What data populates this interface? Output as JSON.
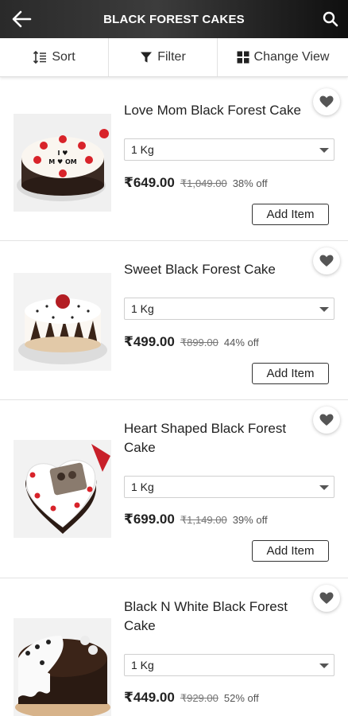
{
  "header": {
    "title": "BLACK FOREST CAKES",
    "back_icon": "arrow-left-icon",
    "search_icon": "search-icon"
  },
  "toolbar": {
    "sort_label": "Sort",
    "filter_label": "Filter",
    "view_label": "Change View"
  },
  "products": [
    {
      "name": "Love Mom Black Forest Cake",
      "weight": "1 Kg",
      "price": "₹649.00",
      "mrp": "₹1,049.00",
      "discount": "38% off",
      "button": "Add Item"
    },
    {
      "name": "Sweet Black Forest Cake",
      "weight": "1 Kg",
      "price": "₹499.00",
      "mrp": "₹899.00",
      "discount": "44% off",
      "button": "Add Item"
    },
    {
      "name": "Heart Shaped Black Forest Cake",
      "weight": "1 Kg",
      "price": "₹699.00",
      "mrp": "₹1,149.00",
      "discount": "39% off",
      "button": "Add Item"
    },
    {
      "name": "Black N White Black Forest Cake",
      "weight": "1 Kg",
      "price": "₹449.00",
      "mrp": "₹929.00",
      "discount": "52% off"
    }
  ],
  "cake1_topper": {
    "line1": "I",
    "line2": "M",
    "line3": "OM"
  }
}
